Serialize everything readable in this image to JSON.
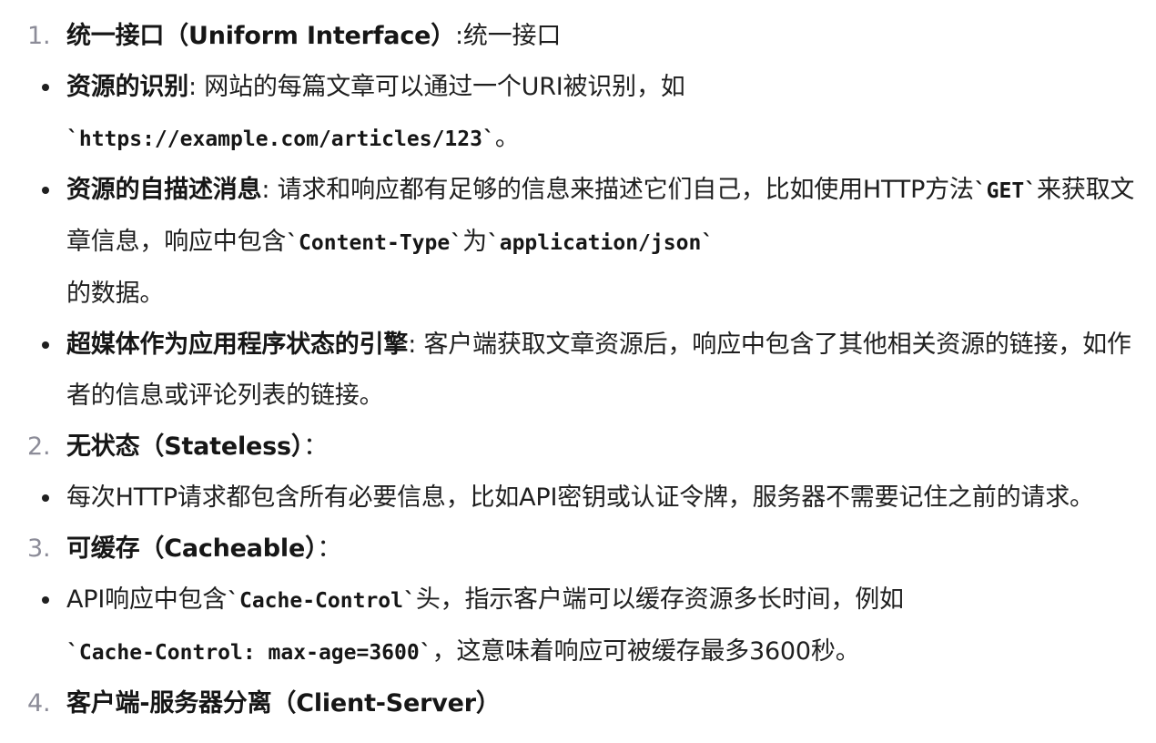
{
  "items": [
    {
      "num": "1.",
      "title": "统一接口（Uniform Interface）",
      "title_suffix": ":统一接口",
      "bullets": [
        {
          "label": "资源的识别",
          "text_1": ": 网站的每篇文章可以通过一个URI被识别，如",
          "code_1": "`https://example.com/articles/123`",
          "text_2": "。"
        },
        {
          "label": "资源的自描述消息",
          "text_1": ": 请求和响应都有足够的信息来描述它们自己，比如使用HTTP方法",
          "code_1": "`GET`",
          "text_2": "来获取文章信息，响应中包含",
          "code_2": "`Content-Type`",
          "text_3": "为",
          "code_3": "`application/json`",
          "text_4": "的数据。"
        },
        {
          "label": "超媒体作为应用程序状态的引擎",
          "text_1": ": 客户端获取文章资源后，响应中包含了其他相关资源的链接，如作者的信息或评论列表的链接。"
        }
      ]
    },
    {
      "num": "2.",
      "title": "无状态（Stateless）",
      "title_suffix": "：",
      "bullets": [
        {
          "text_1": "每次HTTP请求都包含所有必要信息，比如API密钥或认证令牌，服务器不需要记住之前的请求。"
        }
      ]
    },
    {
      "num": "3.",
      "title": "可缓存（Cacheable）",
      "title_suffix": "：",
      "bullets": [
        {
          "text_1": "API响应中包含",
          "code_1": "`Cache-Control`",
          "text_2": "头，指示客户端可以缓存资源多长时间，例如",
          "code_2": "`Cache-Control: max-age=3600`",
          "text_3": "，这意味着响应可被缓存最多3600秒。"
        }
      ]
    },
    {
      "num": "4.",
      "title": "客户端-服务器分离（Client-Server）"
    }
  ]
}
